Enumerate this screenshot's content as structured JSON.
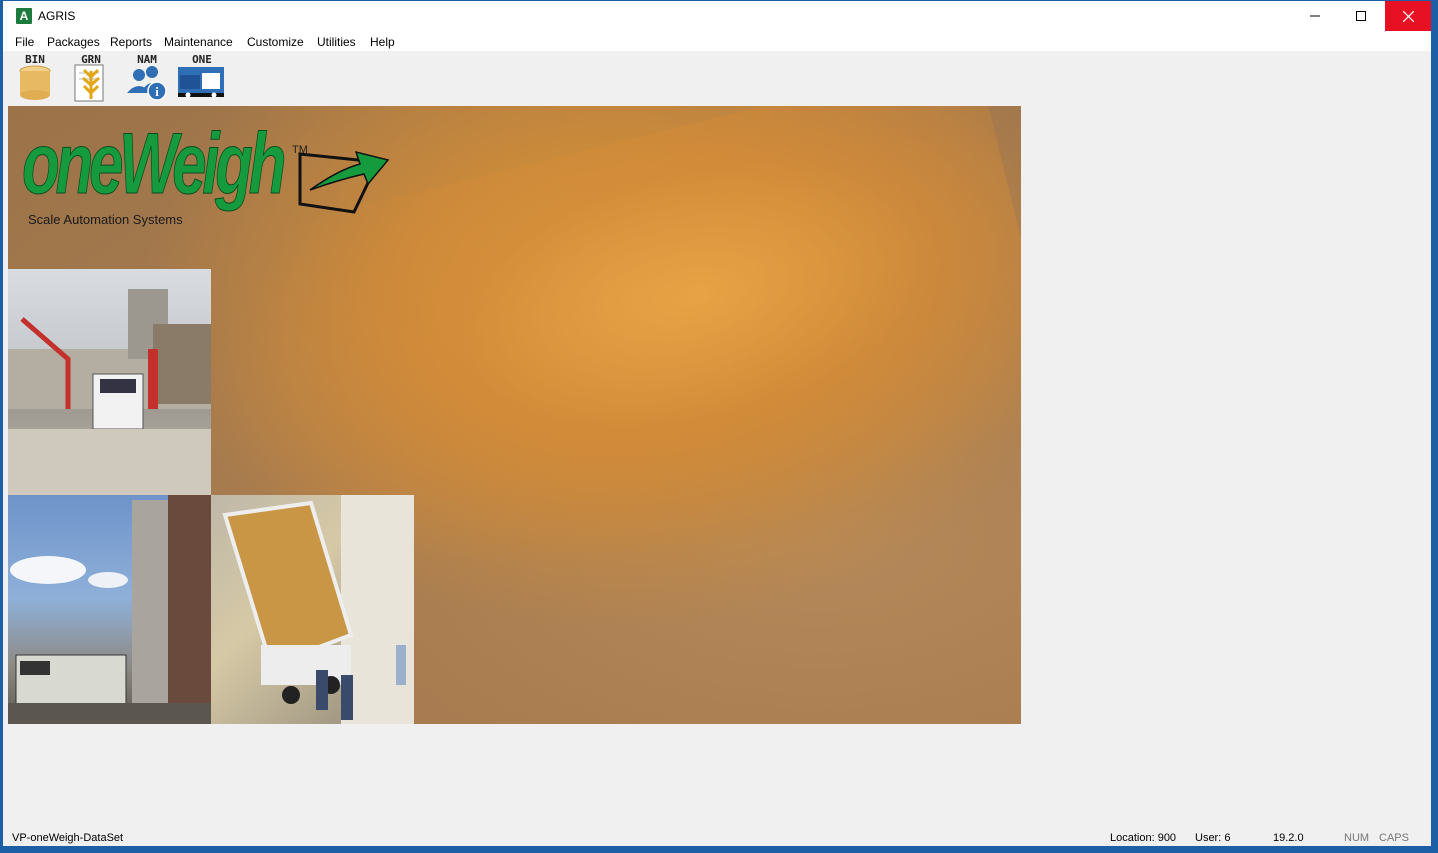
{
  "window": {
    "title": "AGRIS",
    "app_icon_letter": "A"
  },
  "menu": {
    "items": [
      {
        "label": "File"
      },
      {
        "label": "Packages"
      },
      {
        "label": "Reports"
      },
      {
        "label": "Maintenance"
      },
      {
        "label": "Customize"
      },
      {
        "label": "Utilities"
      },
      {
        "label": "Help"
      }
    ]
  },
  "toolbar": {
    "buttons": [
      {
        "label": "BIN",
        "icon": "bin-icon"
      },
      {
        "label": "GRN",
        "icon": "grain-icon"
      },
      {
        "label": "NAM",
        "icon": "name-info-icon"
      },
      {
        "label": "ONE",
        "icon": "truck-icon"
      }
    ]
  },
  "splash": {
    "logo_word": "oneWeigh",
    "logo_tm": "TM",
    "tagline": "Scale Automation Systems"
  },
  "status": {
    "dataset": "VP-oneWeigh-DataSet",
    "location": "Location: 900",
    "user": "User: 6",
    "version": "19.2.0",
    "num": "NUM",
    "caps": "CAPS"
  },
  "colors": {
    "accent": "#1c5fa6",
    "close_button": "#e81123",
    "logo_green": "#169a3e"
  }
}
